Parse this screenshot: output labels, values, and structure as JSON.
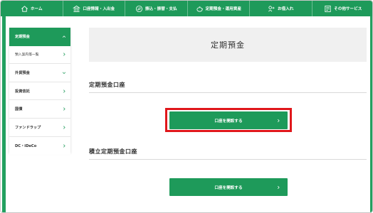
{
  "topnav": {
    "items": [
      {
        "label": "ホーム",
        "icon": "home-icon"
      },
      {
        "label": "口座情報・入出金",
        "icon": "bank-icon"
      },
      {
        "label": "振込・振替・支払",
        "icon": "transfer-icon"
      },
      {
        "label": "定期預金・運用資産",
        "icon": "piggybank-icon"
      },
      {
        "label": "お借入れ",
        "icon": "loan-icon"
      },
      {
        "label": "その他サービス",
        "icon": "services-icon"
      }
    ]
  },
  "sidebar": {
    "items": [
      {
        "label": "定期預金",
        "state": "active",
        "chevron": "up"
      },
      {
        "label": "預入案内等一覧",
        "state": "sub",
        "chevron": "right"
      },
      {
        "label": "外貨預金",
        "state": "normal",
        "chevron": "down"
      },
      {
        "label": "投資信託",
        "state": "normal",
        "chevron": "right"
      },
      {
        "label": "国債",
        "state": "normal",
        "chevron": "right"
      },
      {
        "label": "ファンドラップ",
        "state": "normal",
        "chevron": "right"
      },
      {
        "label": "DC・iDeCo",
        "state": "normal",
        "chevron": "right"
      }
    ]
  },
  "main": {
    "page_title": "定期預金",
    "sections": [
      {
        "title": "定期預金口座",
        "button_label": "口座を開設する",
        "highlighted": true
      },
      {
        "title": "積立定期預金口座",
        "button_label": "口座を開設する",
        "highlighted": false
      }
    ]
  },
  "colors": {
    "brand_green": "#1e9a5a",
    "highlight_red": "#e0171b",
    "title_bg": "#f0f0f0"
  }
}
